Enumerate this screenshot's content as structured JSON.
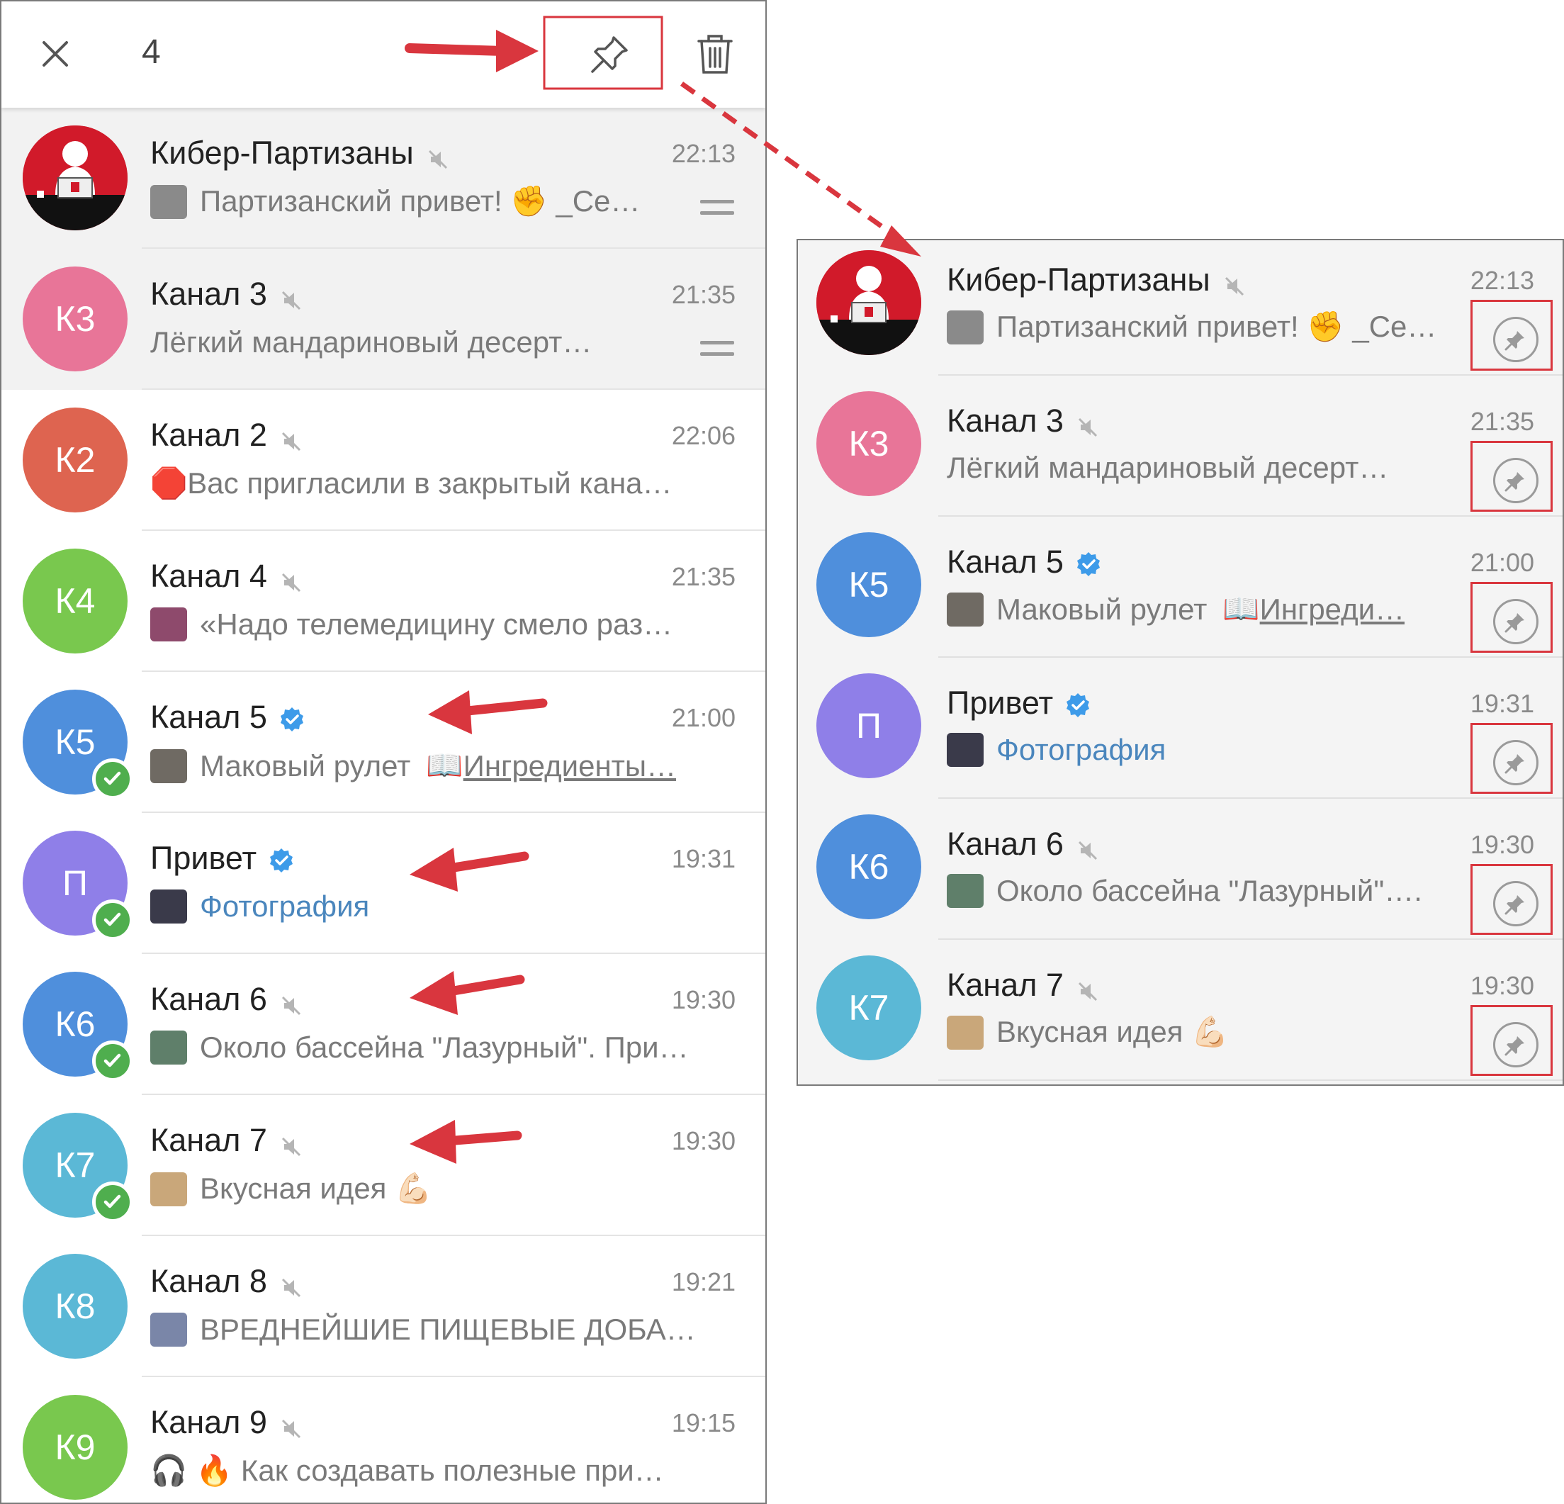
{
  "colors": {
    "annotation_red": "#d9363e",
    "check_green": "#4fae4e",
    "verified_blue": "#3d9be9",
    "link_blue": "#4a86bd"
  },
  "toolbar": {
    "close_icon": "close-icon",
    "selected_count": "4",
    "pin_icon": "pin-icon",
    "delete_icon": "trash-icon"
  },
  "left_list": [
    {
      "name": "Кибер-Партизаны",
      "initials": "",
      "avatar_color": "#d11a2a",
      "time": "22:13",
      "message": "Партизанский привет! ✊ _Се…",
      "thumb_color": "#8a8a8a",
      "muted": true,
      "verified": false,
      "selected": false,
      "pinned": true
    },
    {
      "name": "Канал 3",
      "initials": "К3",
      "avatar_color": "#e87598",
      "time": "21:35",
      "message": "Лёгкий мандариновый десерт…",
      "thumb_color": "",
      "muted": true,
      "verified": false,
      "selected": false,
      "pinned": true
    },
    {
      "name": "Канал 2",
      "initials": "К2",
      "avatar_color": "#de6450",
      "time": "22:06",
      "message": "🛑Вас пригласили в закрытый кана…",
      "thumb_color": "",
      "muted": true,
      "verified": false,
      "selected": false,
      "pinned": false
    },
    {
      "name": "Канал 4",
      "initials": "К4",
      "avatar_color": "#79c84e",
      "time": "21:35",
      "message": "«Надо телемедицину смело раз…",
      "thumb_color": "#8e4a6c",
      "muted": true,
      "verified": false,
      "selected": false,
      "pinned": false
    },
    {
      "name": "Канал 5",
      "initials": "К5",
      "avatar_color": "#4f8fdc",
      "time": "21:00",
      "message": "Маковый рулет",
      "message_extra": "📖 ",
      "message_link": "Ингредиенты…",
      "thumb_color": "#6f6a63",
      "muted": false,
      "verified": true,
      "selected": true,
      "pinned": false
    },
    {
      "name": "Привет",
      "initials": "П",
      "avatar_color": "#8f7fe8",
      "time": "19:31",
      "message": "Фотография",
      "thumb_color": "#3a3a4a",
      "muted": false,
      "verified": true,
      "selected": true,
      "pinned": false,
      "message_is_link": true
    },
    {
      "name": "Канал 6",
      "initials": "К6",
      "avatar_color": "#4f8fdc",
      "time": "19:30",
      "message": "Около бассейна \"Лазурный\". При…",
      "thumb_color": "#5f7f6a",
      "muted": true,
      "verified": false,
      "selected": true,
      "pinned": false
    },
    {
      "name": "Канал 7",
      "initials": "К7",
      "avatar_color": "#5bb8d6",
      "time": "19:30",
      "message": "Вкусная идея 💪🏻",
      "thumb_color": "#c9a77a",
      "muted": true,
      "verified": false,
      "selected": true,
      "pinned": false
    },
    {
      "name": "Канал 8",
      "initials": "К8",
      "avatar_color": "#5bb8d6",
      "time": "19:21",
      "message": "ВРЕДНЕЙШИЕ ПИЩЕВЫЕ ДОБА…",
      "thumb_color": "#7a86a8",
      "muted": true,
      "verified": false,
      "selected": false,
      "pinned": false
    },
    {
      "name": "Канал 9",
      "initials": "К9",
      "avatar_color": "#79c84e",
      "time": "19:15",
      "message": "🎧 🔥 Как создавать полезные при…",
      "thumb_color": "",
      "muted": true,
      "verified": false,
      "selected": false,
      "pinned": false
    }
  ],
  "right_list": [
    {
      "name": "Кибер-Партизаны",
      "initials": "",
      "avatar_color": "#d11a2a",
      "time": "22:13",
      "message": "Партизанский привет! ✊ _Се…",
      "thumb_color": "#8a8a8a",
      "muted": true,
      "verified": false
    },
    {
      "name": "Канал 3",
      "initials": "К3",
      "avatar_color": "#e87598",
      "time": "21:35",
      "message": "Лёгкий мандариновый десерт…",
      "thumb_color": "",
      "muted": true,
      "verified": false
    },
    {
      "name": "Канал 5",
      "initials": "К5",
      "avatar_color": "#4f8fdc",
      "time": "21:00",
      "message": "Маковый рулет",
      "message_extra": "📖 ",
      "message_link": "Ингреди…",
      "thumb_color": "#6f6a63",
      "muted": false,
      "verified": true
    },
    {
      "name": "Привет",
      "initials": "П",
      "avatar_color": "#8f7fe8",
      "time": "19:31",
      "message": "Фотография",
      "thumb_color": "#3a3a4a",
      "muted": false,
      "verified": true,
      "message_is_link": true
    },
    {
      "name": "Канал 6",
      "initials": "К6",
      "avatar_color": "#4f8fdc",
      "time": "19:30",
      "message": "Около бассейна \"Лазурный\"….",
      "thumb_color": "#5f7f6a",
      "muted": true,
      "verified": false
    },
    {
      "name": "Канал 7",
      "initials": "К7",
      "avatar_color": "#5bb8d6",
      "time": "19:30",
      "message": "Вкусная идея 💪🏻",
      "thumb_color": "#c9a77a",
      "muted": true,
      "verified": false
    }
  ]
}
